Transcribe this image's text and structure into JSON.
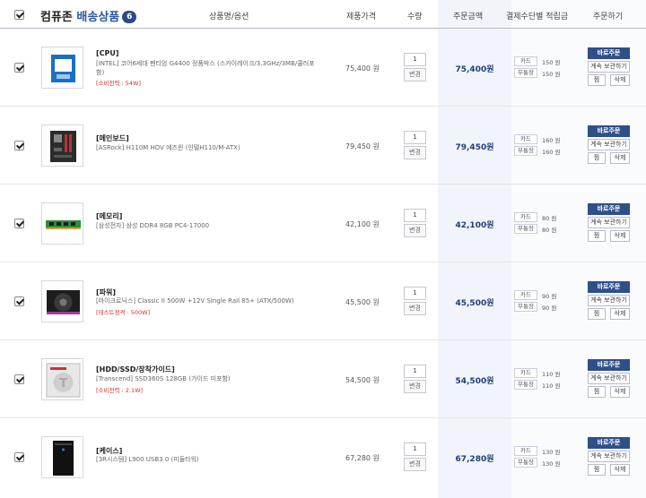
{
  "header": {
    "title_prefix": "컴퓨존",
    "title_highlight": "배송상품",
    "count": "6",
    "col_product": "상품명/옵션",
    "col_price": "제품가격",
    "col_qty": "수량",
    "col_amount": "주문금액",
    "col_points": "결제수단별 적립금",
    "col_order": "주문하기"
  },
  "labels": {
    "change": "변경",
    "card": "카드",
    "bank": "무통장",
    "buy_now": "바로주문",
    "wishlist": "계속 보관하기",
    "zzim": "찜",
    "delete": "삭제"
  },
  "items": [
    {
      "category": "[CPU]",
      "name": "[INTEL] 코어6세대 펜티엄 G4400 정품박스 (스카이레이크/3.3GHz/3MB/쿨러포함)",
      "spec": "[소비전력 : 54W]",
      "price": "75,400 원",
      "qty": "1",
      "amount": "75,400원",
      "card_pt": "150 원",
      "bank_pt": "150 원"
    },
    {
      "category": "[메인보드]",
      "name": "[ASRock] H110M HDV 에즈윈 (인텔H110/M-ATX)",
      "spec": "",
      "price": "79,450 원",
      "qty": "1",
      "amount": "79,450원",
      "card_pt": "160 원",
      "bank_pt": "160 원"
    },
    {
      "category": "[메모리]",
      "name": "[삼성전자] 삼성 DDR4 8GB PC4-17000",
      "spec": "",
      "price": "42,100 원",
      "qty": "1",
      "amount": "42,100원",
      "card_pt": "80 원",
      "bank_pt": "80 원"
    },
    {
      "category": "[파워]",
      "name": "[마이크로닉스] Classic II 500W +12V Single Rail 85+ (ATX/500W)",
      "spec": "[테스트정격 : 500W]",
      "price": "45,500 원",
      "qty": "1",
      "amount": "45,500원",
      "card_pt": "90 원",
      "bank_pt": "90 원"
    },
    {
      "category": "[HDD/SSD/장착가이드]",
      "name": "[Transcend] SSD360S 128GB (가이드 미포함)",
      "spec": "[소비전력 : 2.1W]",
      "price": "54,500 원",
      "qty": "1",
      "amount": "54,500원",
      "card_pt": "110 원",
      "bank_pt": "110 원"
    },
    {
      "category": "[케이스]",
      "name": "[3R시스템] L900 USB3.0 (미들타워)",
      "spec": "",
      "price": "67,280 원",
      "qty": "1",
      "amount": "67,280원",
      "card_pt": "130 원",
      "bank_pt": "130 원"
    }
  ]
}
